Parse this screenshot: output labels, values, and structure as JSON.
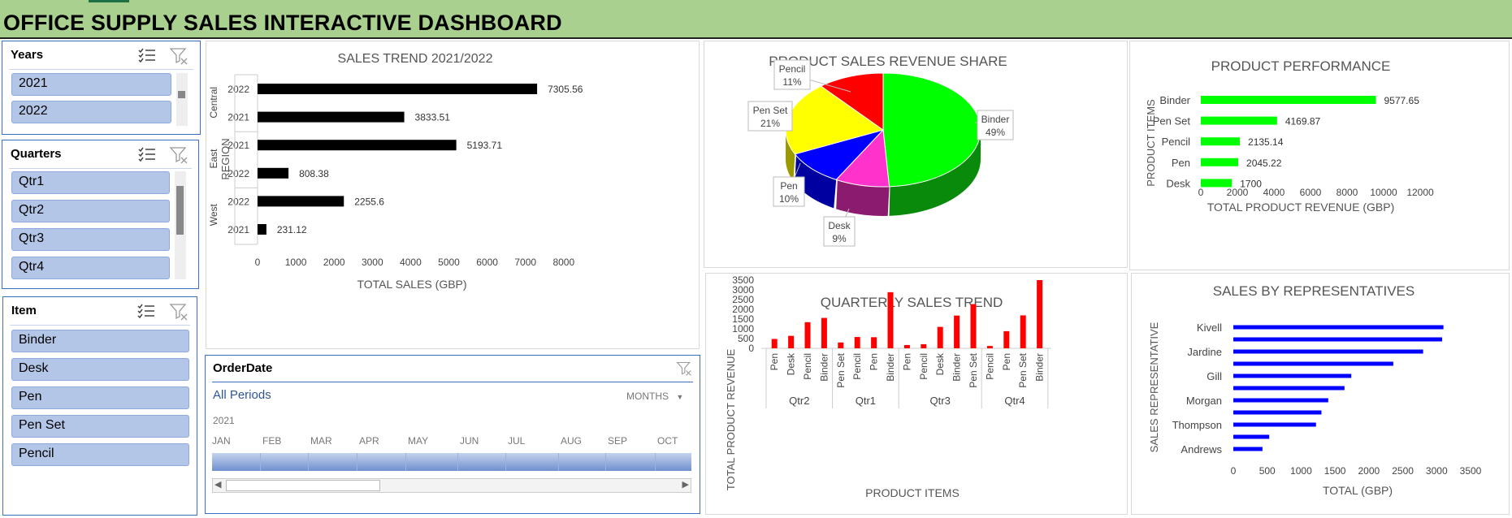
{
  "dashboard": {
    "title": "OFFICE SUPPLY SALES INTERACTIVE DASHBOARD"
  },
  "slicers": {
    "years": {
      "title": "Years",
      "items": [
        "2021",
        "2022"
      ]
    },
    "quarters": {
      "title": "Quarters",
      "items": [
        "Qtr1",
        "Qtr2",
        "Qtr3",
        "Qtr4"
      ]
    },
    "item": {
      "title": "Item",
      "items": [
        "Binder",
        "Desk",
        "Pen",
        "Pen Set",
        "Pencil"
      ]
    }
  },
  "orderdate": {
    "title": "OrderDate",
    "all_periods": "All Periods",
    "level": "MONTHS",
    "year": "2021",
    "months": [
      "JAN",
      "FEB",
      "MAR",
      "APR",
      "MAY",
      "JUN",
      "JUL",
      "AUG",
      "SEP",
      "OCT"
    ]
  },
  "chart_data": [
    {
      "id": "sales_trend",
      "type": "bar",
      "orientation": "horizontal",
      "title": "SALES TREND 2021/2022",
      "xlabel": "TOTAL SALES (GBP)",
      "ylabel": "REGION",
      "groups": [
        {
          "name": "Central",
          "categories": [
            "2022",
            "2021"
          ],
          "values": [
            7305.56,
            3833.51
          ]
        },
        {
          "name": "East",
          "categories": [
            "2021",
            "2022"
          ],
          "values": [
            5193.71,
            808.38
          ]
        },
        {
          "name": "West",
          "categories": [
            "2022",
            "2021"
          ],
          "values": [
            2255.6,
            231.12
          ]
        }
      ],
      "xlim": [
        0,
        8000
      ],
      "xticks": [
        0,
        1000,
        2000,
        3000,
        4000,
        5000,
        6000,
        7000,
        8000
      ],
      "color": "#000000",
      "data_labels": true
    },
    {
      "id": "revenue_share",
      "type": "pie",
      "title": "PRODUCT SALES REVENUE SHARE",
      "slices": [
        {
          "label": "Binder",
          "pct": "49%",
          "value": 49,
          "color": "#00ff00"
        },
        {
          "label": "Desk",
          "pct": "9%",
          "value": 9,
          "color": "#ff33cc"
        },
        {
          "label": "Pen",
          "pct": "10%",
          "value": 10,
          "color": "#0000ff"
        },
        {
          "label": "Pen Set",
          "pct": "21%",
          "value": 21,
          "color": "#ffff00"
        },
        {
          "label": "Pencil",
          "pct": "11%",
          "value": 11,
          "color": "#ff0000"
        }
      ]
    },
    {
      "id": "product_performance",
      "type": "bar",
      "orientation": "horizontal",
      "title": "PRODUCT PERFORMANCE",
      "xlabel": "TOTAL PRODUCT REVENUE (GBP)",
      "ylabel": "PRODUCT ITEMS",
      "categories": [
        "Binder",
        "Pen Set",
        "Pencil",
        "Pen",
        "Desk"
      ],
      "values": [
        9577.65,
        4169.87,
        2135.14,
        2045.22,
        1700
      ],
      "value_labels": [
        "9577.65",
        "4169.87",
        "2135.14",
        "2045.22",
        "1700"
      ],
      "xlim": [
        0,
        12000
      ],
      "xticks": [
        0,
        2000,
        4000,
        6000,
        8000,
        10000,
        12000
      ],
      "color": "#00ff00"
    },
    {
      "id": "quarterly_trend",
      "type": "bar",
      "title": "QUARTERLY SALES TREND",
      "xlabel": "PRODUCT ITEMS",
      "ylabel": "TOTAL PRODUCT REVENUE",
      "groups": [
        {
          "name": "Qtr2",
          "categories": [
            "Pen",
            "Desk",
            "Pencil",
            "Binder"
          ],
          "values": [
            480,
            640,
            1340,
            1560
          ]
        },
        {
          "name": "Qtr1",
          "categories": [
            "Pen Set",
            "Pencil",
            "Pen",
            "Binder"
          ],
          "values": [
            300,
            580,
            570,
            2880
          ]
        },
        {
          "name": "Qtr3",
          "categories": [
            "Pen",
            "Pencil",
            "Desk",
            "Binder",
            "Pen Set"
          ],
          "values": [
            170,
            210,
            1100,
            1680,
            2270
          ]
        },
        {
          "name": "Qtr4",
          "categories": [
            "Pencil",
            "Pen",
            "Pen Set",
            "Binder"
          ],
          "values": [
            120,
            880,
            1690,
            3500
          ]
        }
      ],
      "ylim": [
        0,
        4000
      ],
      "yticks": [
        0,
        500,
        1000,
        1500,
        2000,
        2500,
        3000,
        3500,
        4000
      ],
      "color": "#ff0000"
    },
    {
      "id": "sales_by_rep",
      "type": "bar",
      "orientation": "horizontal",
      "title": "SALES BY REPRESENTATIVES",
      "xlabel": "TOTAL (GBP)",
      "ylabel": "SALES REPRESENTATIVE",
      "categories": [
        "Kivell",
        "",
        "Jardine",
        "",
        "Gill",
        "",
        "Morgan",
        "",
        "Thompson",
        "",
        "Andrews"
      ],
      "values": [
        3100,
        3080,
        2800,
        2360,
        1740,
        1640,
        1400,
        1300,
        1220,
        530,
        430
      ],
      "xlim": [
        0,
        3500
      ],
      "xticks": [
        0,
        500,
        1000,
        1500,
        2000,
        2500,
        3000,
        3500
      ],
      "color": "#0000ff"
    }
  ]
}
